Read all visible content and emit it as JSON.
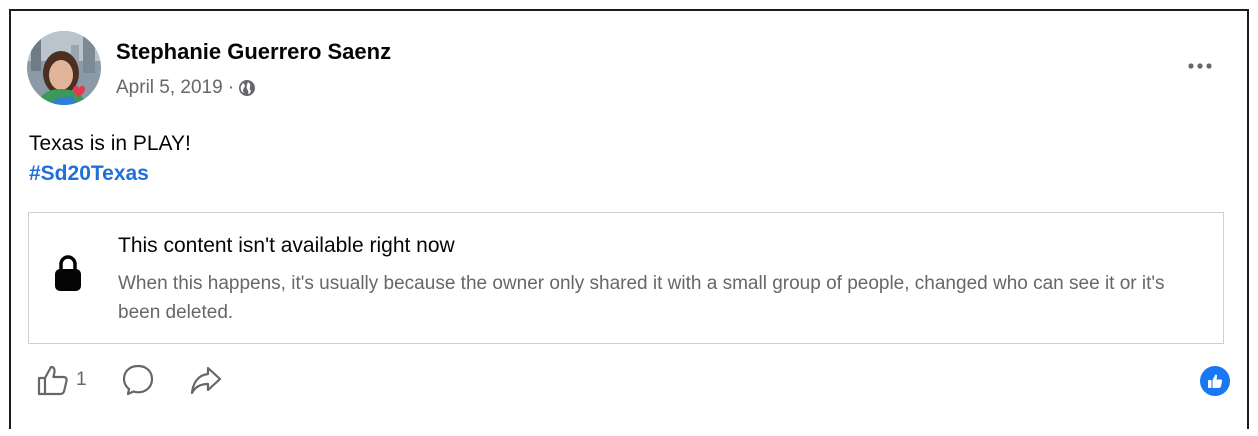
{
  "post": {
    "author": "Stephanie Guerrero Saenz",
    "date": "April 5, 2019",
    "separator": "·",
    "privacy_icon": "globe-icon",
    "text": "Texas is in PLAY!",
    "hashtag": "#Sd20Texas",
    "accent_color": "#216fdb"
  },
  "unavailable": {
    "icon": "lock-icon",
    "title": "This content isn't available right now",
    "description": "When this happens, it's usually because the owner only shared it with a small group of people, changed who can see it or it's been deleted."
  },
  "actions": {
    "like_icon": "thumbs-up-icon",
    "like_count": "1",
    "comment_icon": "comment-icon",
    "share_icon": "share-icon",
    "reaction_icon": "like-reaction-icon"
  },
  "menu": {
    "icon": "more-options-icon"
  }
}
